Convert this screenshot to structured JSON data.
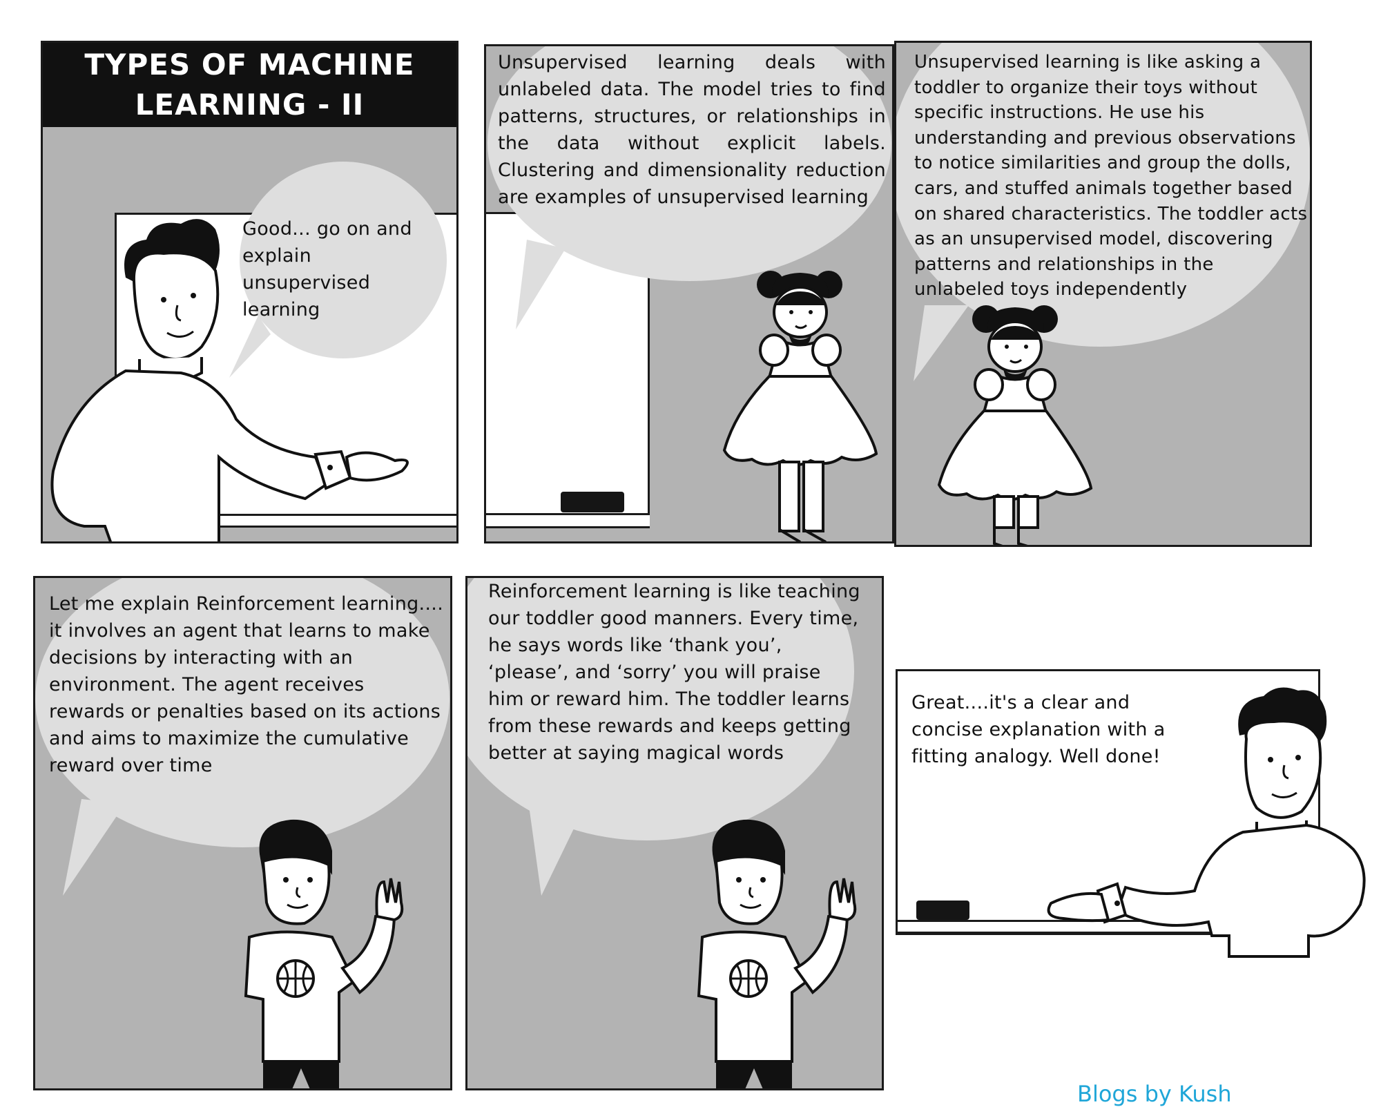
{
  "panels": {
    "p1": {
      "title": "TYPES OF MACHINE LEARNING - II",
      "speech": "Good... go on and explain unsupervised learning"
    },
    "p2": {
      "speech": "Unsupervised learning deals with unlabeled data. The model tries to find patterns, structures, or relationships in the data without explicit labels. Clustering and dimensionality reduction are examples of unsupervised learning"
    },
    "p3": {
      "speech": "Unsupervised learning is like asking a toddler to organize their toys without specific instructions. He use his understanding and previous observations to notice similarities and group the dolls, cars, and stuffed animals together based on shared characteristics. The toddler acts as an unsupervised model, discovering patterns and relationships in the unlabeled toys independently"
    },
    "p4": {
      "speech": "Let me explain Reinforcement learning.... it involves an agent that learns to make decisions by interacting with an environment. The agent receives rewards or penalties based on its actions and aims to maximize the cumulative reward over time"
    },
    "p5": {
      "speech": "Reinforcement learning is like teaching our toddler good manners. Every time, he says words like ‘thank you’, ‘please’, and ‘sorry’ you will praise him or reward him. The toddler learns from these rewards and keeps getting better at saying magical words"
    },
    "p6": {
      "speech": "Great....it's a clear and concise explanation with a fitting analogy. Well done!"
    }
  },
  "credit": "Blogs by Kush",
  "colors": {
    "panel_gray": "#b3b3b3",
    "bubble": "#dedede",
    "ink": "#111111",
    "credit": "#1fa6d8"
  }
}
